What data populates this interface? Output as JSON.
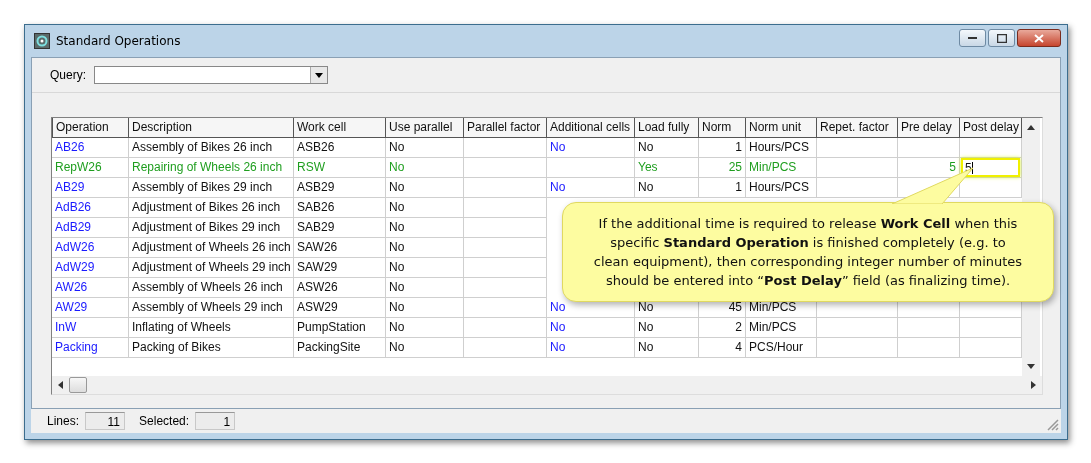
{
  "window": {
    "title": "Standard Operations"
  },
  "query": {
    "label": "Query:"
  },
  "table": {
    "columns": [
      {
        "label": "Operation",
        "kind": "link"
      },
      {
        "label": "Description",
        "kind": "text"
      },
      {
        "label": "Work cell",
        "kind": "text"
      },
      {
        "label": "Use parallel",
        "kind": "text"
      },
      {
        "label": "Parallel factor",
        "kind": "number"
      },
      {
        "label": "Additional cells",
        "kind": "link"
      },
      {
        "label": "Load fully",
        "kind": "text"
      },
      {
        "label": "Norm",
        "kind": "number"
      },
      {
        "label": "Norm unit",
        "kind": "text"
      },
      {
        "label": "Repet. factor",
        "kind": "number"
      },
      {
        "label": "Pre delay",
        "kind": "number"
      },
      {
        "label": "Post delay",
        "kind": "number"
      }
    ],
    "rows": [
      {
        "selected": false,
        "editing": false,
        "cells": [
          "AB26",
          "Assembly of Bikes 26 inch",
          "ASB26",
          "No",
          "",
          "No",
          "No",
          "1",
          "Hours/PCS",
          "",
          "",
          ""
        ]
      },
      {
        "selected": true,
        "editing": true,
        "cells": [
          "RepW26",
          "Repairing of Wheels 26 inch",
          "RSW",
          "No",
          "",
          "",
          "Yes",
          "25",
          "Min/PCS",
          "",
          "5",
          "5"
        ]
      },
      {
        "selected": false,
        "editing": false,
        "cells": [
          "AB29",
          "Assembly of Bikes 29 inch",
          "ASB29",
          "No",
          "",
          "No",
          "No",
          "1",
          "Hours/PCS",
          "",
          "",
          ""
        ]
      },
      {
        "selected": false,
        "editing": false,
        "cells": [
          "AdB26",
          "Adjustment of Bikes 26 inch",
          "SAB26",
          "No",
          ""
        ]
      },
      {
        "selected": false,
        "editing": false,
        "cells": [
          "AdB29",
          "Adjustment of Bikes 29 inch",
          "SAB29",
          "No",
          ""
        ]
      },
      {
        "selected": false,
        "editing": false,
        "cells": [
          "AdW26",
          "Adjustment of Wheels 26 inch",
          "SAW26",
          "No",
          ""
        ]
      },
      {
        "selected": false,
        "editing": false,
        "cells": [
          "AdW29",
          "Adjustment of Wheels 29 inch",
          "SAW29",
          "No",
          ""
        ]
      },
      {
        "selected": false,
        "editing": false,
        "cells": [
          "AW26",
          "Assembly of Wheels 26 inch",
          "ASW26",
          "No",
          ""
        ]
      },
      {
        "selected": false,
        "editing": false,
        "cells": [
          "AW29",
          "Assembly of Wheels 29 inch",
          "ASW29",
          "No",
          "",
          "No",
          "No",
          "45",
          "Min/PCS",
          "",
          "",
          ""
        ]
      },
      {
        "selected": false,
        "editing": false,
        "cells": [
          "InW",
          "Inflating of Wheels",
          "PumpStation",
          "No",
          "",
          "No",
          "No",
          "2",
          "Min/PCS",
          "",
          "",
          ""
        ]
      },
      {
        "selected": false,
        "editing": false,
        "cells": [
          "Packing",
          "Packing of Bikes",
          "PackingSite",
          "No",
          "",
          "No",
          "No",
          "4",
          "PCS/Hour",
          "",
          "",
          ""
        ]
      }
    ]
  },
  "callout": {
    "text": "If the additional time is required to release **Work Cell** when this specific **Standard Operation** is finished completely (e.g. to clean equipment), then corresponding integer number of minutes should be entered into “**Post Delay**” field (as finalizing time)."
  },
  "status_bar": [
    {
      "label": "Lines:",
      "value": "11"
    },
    {
      "label": "Selected:",
      "value": "1"
    }
  ]
}
